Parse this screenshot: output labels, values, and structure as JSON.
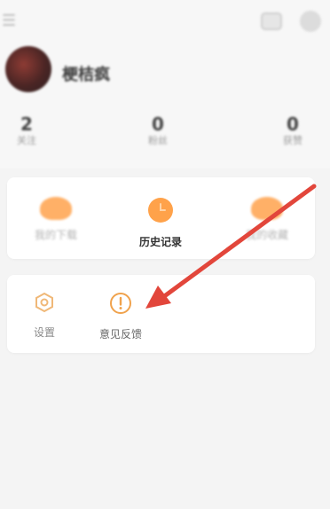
{
  "profile": {
    "username": "梗桔疯"
  },
  "stats": [
    {
      "value": "2",
      "label": "关注"
    },
    {
      "value": "0",
      "label": "粉丝"
    },
    {
      "value": "0",
      "label": "获赞"
    }
  ],
  "quick_menu": {
    "items": [
      {
        "label": "我的下载",
        "icon": "download-icon"
      },
      {
        "label": "历史记录",
        "icon": "clock-icon"
      },
      {
        "label": "我的收藏",
        "icon": "star-icon"
      }
    ]
  },
  "tools_menu": {
    "items": [
      {
        "label": "设置",
        "icon": "gear-icon"
      },
      {
        "label": "意见反馈",
        "icon": "feedback-icon"
      }
    ]
  },
  "colors": {
    "accent_orange": "#ffa24a",
    "annotation_red": "#e2463b",
    "background": "#f4f4f4"
  }
}
